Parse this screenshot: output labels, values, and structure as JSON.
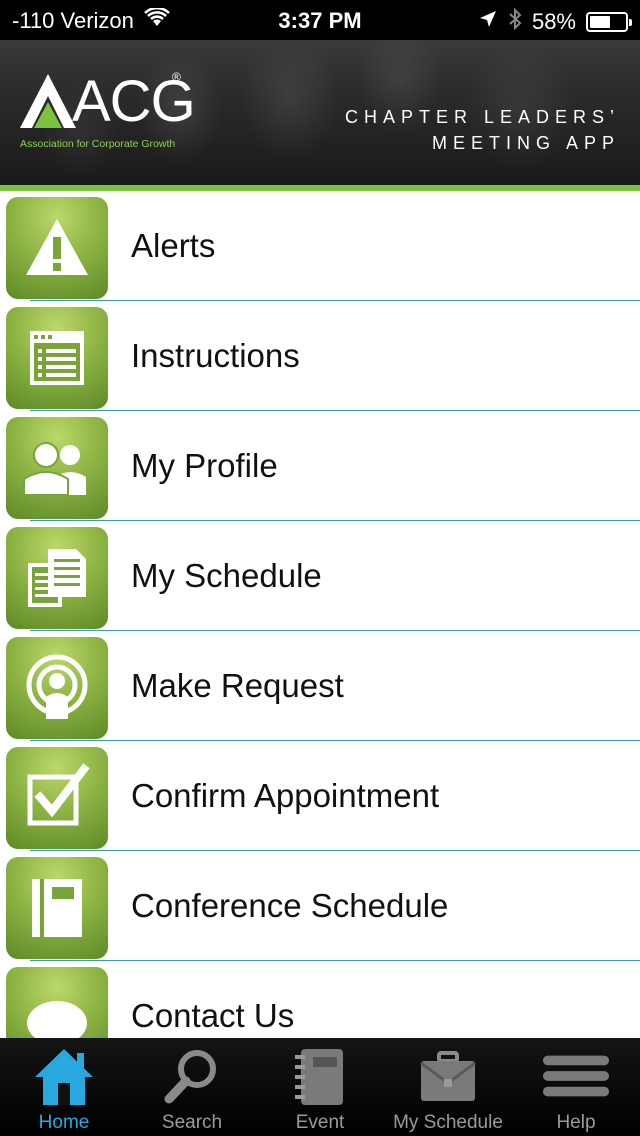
{
  "status_bar": {
    "carrier": "-110 Verizon",
    "time": "3:37 PM",
    "battery_percent_text": "58%",
    "battery_level": 0.58
  },
  "header": {
    "logo_text": "ACG",
    "logo_subtitle": "Association for Corporate Growth",
    "tagline_line1": "CHAPTER LEADERS’",
    "tagline_line2": "MEETING APP",
    "accent_color": "#7cc142"
  },
  "menu": {
    "items": [
      {
        "label": "Alerts",
        "icon": "warning-icon"
      },
      {
        "label": "Instructions",
        "icon": "document-list-icon"
      },
      {
        "label": "My Profile",
        "icon": "people-icon"
      },
      {
        "label": "My Schedule",
        "icon": "documents-icon"
      },
      {
        "label": "Make Request",
        "icon": "broadcast-person-icon"
      },
      {
        "label": "Confirm Appointment",
        "icon": "checkbox-icon"
      },
      {
        "label": "Conference Schedule",
        "icon": "notebook-icon"
      },
      {
        "label": "Contact Us",
        "icon": "speech-bubble-icon"
      }
    ]
  },
  "tabbar": {
    "items": [
      {
        "label": "Home",
        "icon": "home-icon",
        "active": true
      },
      {
        "label": "Search",
        "icon": "search-icon",
        "active": false
      },
      {
        "label": "Event",
        "icon": "notebook-icon",
        "active": false
      },
      {
        "label": "My Schedule",
        "icon": "briefcase-icon",
        "active": false
      },
      {
        "label": "Help",
        "icon": "menu-lines-icon",
        "active": false
      }
    ],
    "active_color": "#29a8e0",
    "inactive_color": "#9a9a9a"
  }
}
